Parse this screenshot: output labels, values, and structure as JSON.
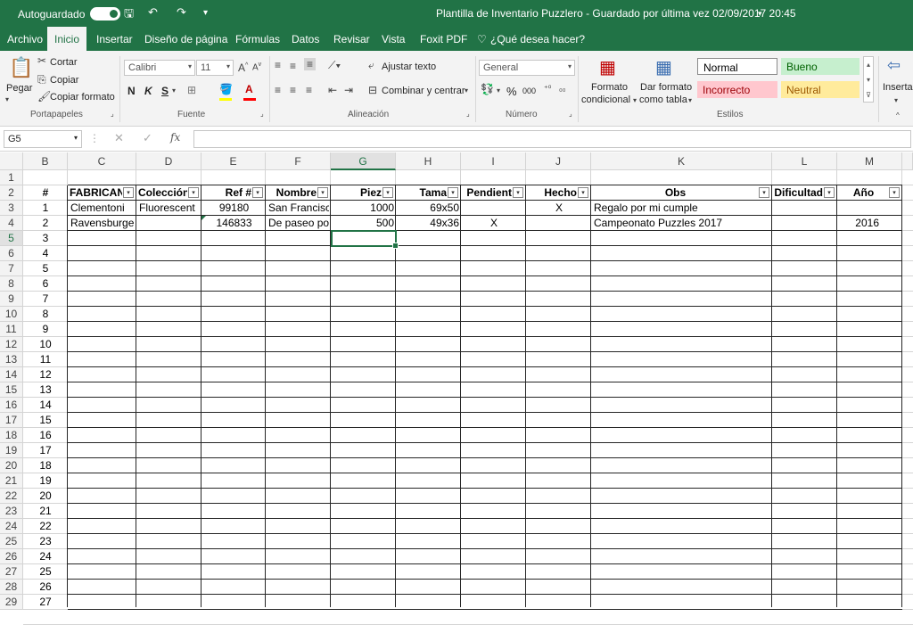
{
  "titlebar": {
    "autosave_label": "Autoguardado",
    "title": "Plantilla de Inventario Puzzlero  -  Guardado por última vez 02/09/2017 20:45",
    "title_dropdown_icon": "chevron-down-icon"
  },
  "menu": {
    "items": [
      "Archivo",
      "Inicio",
      "Insertar",
      "Diseño de página",
      "Fórmulas",
      "Datos",
      "Revisar",
      "Vista",
      "Foxit PDF"
    ],
    "active": "Inicio",
    "tell_me": "¿Qué desea hacer?"
  },
  "ribbon": {
    "clipboard": {
      "paste": "Pegar",
      "cut": "Cortar",
      "copy": "Copiar",
      "format_painter": "Copiar formato",
      "label": "Portapapeles"
    },
    "font": {
      "name": "Calibri",
      "size": "11",
      "bold": "N",
      "italic": "K",
      "underline": "S",
      "label": "Fuente"
    },
    "alignment": {
      "wrap": "Ajustar texto",
      "merge": "Combinar y centrar",
      "label": "Alineación"
    },
    "number": {
      "format": "General",
      "percent": "%",
      "thousands": "000",
      "label": "Número"
    },
    "styles": {
      "conditional_1": "Formato",
      "conditional_2": "condicional",
      "table_1": "Dar formato",
      "table_2": "como tabla",
      "normal": "Normal",
      "good": "Bueno",
      "bad": "Incorrecto",
      "neutral": "Neutral",
      "label": "Estilos",
      "good_bg": "#c6efce",
      "bad_bg": "#ffc7ce",
      "neutral_bg": "#ffeb9c"
    },
    "insert": "Insertar"
  },
  "formula_bar": {
    "name_box": "G5",
    "fx": "fx",
    "value": ""
  },
  "sheet": {
    "columns": [
      "B",
      "C",
      "D",
      "E",
      "F",
      "G",
      "H",
      "I",
      "J",
      "K",
      "L",
      "M"
    ],
    "selected_column": "G",
    "rows": [
      "1",
      "2",
      "3",
      "4",
      "5",
      "6",
      "7",
      "8",
      "9",
      "10",
      "11",
      "12",
      "13",
      "14",
      "15",
      "16",
      "17",
      "18",
      "19",
      "20",
      "21",
      "22",
      "23",
      "24",
      "25",
      "26",
      "27",
      "28",
      "29"
    ],
    "selected_row": "5",
    "headers": [
      "#",
      "FABRICANT",
      "Colección",
      "Ref #",
      "Nombre",
      "Piez",
      "Tama",
      "Pendient",
      "Hecho",
      "Obs",
      "Dificultad",
      "Año"
    ],
    "index_values": [
      "1",
      "2",
      "3",
      "4",
      "5",
      "6",
      "7",
      "8",
      "9",
      "10",
      "11",
      "12",
      "13",
      "14",
      "15",
      "16",
      "17",
      "18",
      "19",
      "20",
      "21",
      "22",
      "23",
      "24",
      "25",
      "26",
      "27"
    ],
    "data_rows": [
      {
        "fabricante": "Clementoni",
        "coleccion": "Fluorescent",
        "ref": "99180",
        "nombre": "San Francisco",
        "piezas": "1000",
        "tamano": "69x50",
        "pendiente": "",
        "hecho": "X",
        "obs": "Regalo por mi cumple",
        "dificultad": "",
        "ano": ""
      },
      {
        "fabricante": "Ravensburger",
        "coleccion": "",
        "ref": "146833",
        "nombre": "De paseo por",
        "piezas": "500",
        "tamano": "49x36",
        "pendiente": "X",
        "hecho": "",
        "obs": "Campeonato Puzzles 2017",
        "dificultad": "",
        "ano": "2016"
      }
    ]
  },
  "colors": {
    "accent": "#217346"
  }
}
